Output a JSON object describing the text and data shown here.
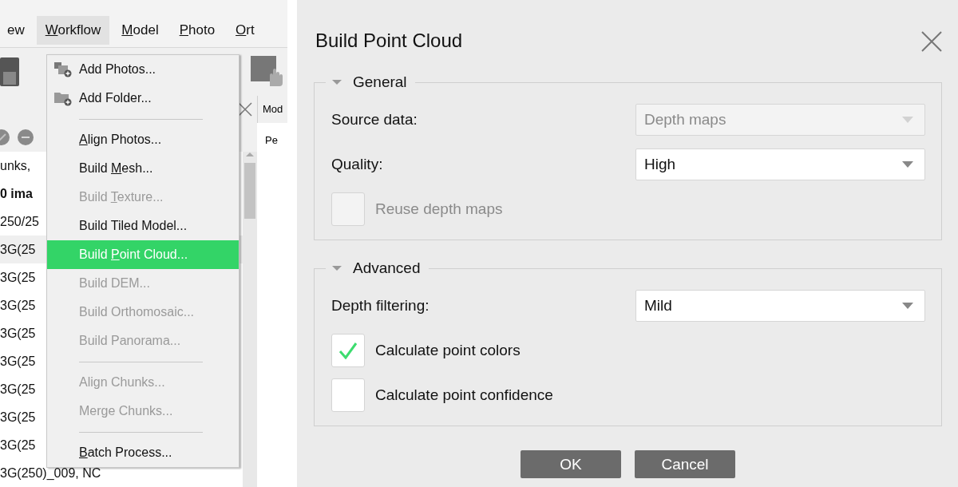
{
  "app": {
    "menubar": [
      {
        "text": "ew",
        "selected": false
      },
      {
        "key": "W",
        "rest": "orkflow",
        "selected": true
      },
      {
        "key": "M",
        "rest": "odel",
        "selected": false
      },
      {
        "key": "P",
        "rest": "hoto",
        "selected": false
      },
      {
        "key": "O",
        "rest": "rt",
        "selected": false
      }
    ],
    "tree_rows": [
      {
        "text": "unks,",
        "bold": false,
        "selected": false
      },
      {
        "text": "0 ima",
        "bold": true,
        "selected": false
      },
      {
        "text": "250/25",
        "bold": false,
        "selected": false
      },
      {
        "text": "3G(25",
        "bold": false,
        "selected": true
      },
      {
        "text": "3G(25",
        "bold": false,
        "selected": false
      },
      {
        "text": "3G(25",
        "bold": false,
        "selected": false
      },
      {
        "text": "3G(25",
        "bold": false,
        "selected": false
      },
      {
        "text": "3G(25",
        "bold": false,
        "selected": false
      },
      {
        "text": "3G(25",
        "bold": false,
        "selected": false
      },
      {
        "text": "3G(25",
        "bold": false,
        "selected": false
      },
      {
        "text": "3G(25",
        "bold": false,
        "selected": false
      },
      {
        "text": "3G(250)_009, NC",
        "bold": false,
        "selected": false
      }
    ],
    "side_tab": "Mod",
    "side_text": "Pe",
    "menu": [
      {
        "kind": "item",
        "text": "Add Photos...",
        "disabled": false,
        "selected": false
      },
      {
        "kind": "item",
        "text": "Add Folder...",
        "disabled": false,
        "selected": false
      },
      {
        "kind": "separator"
      },
      {
        "kind": "item",
        "key": "A",
        "rest": "lign Photos...",
        "disabled": false,
        "selected": false
      },
      {
        "kind": "item",
        "text": "Build ",
        "key": "M",
        "rest": "esh...",
        "disabled": false,
        "selected": false
      },
      {
        "kind": "item",
        "text": "Build ",
        "key": "T",
        "rest": "exture...",
        "disabled": true,
        "selected": false
      },
      {
        "kind": "item",
        "text": "Build Tiled Model...",
        "disabled": false,
        "selected": false
      },
      {
        "kind": "item",
        "text": "Build ",
        "key": "P",
        "rest": "oint Cloud...",
        "disabled": false,
        "selected": true
      },
      {
        "kind": "item",
        "text": "Build DEM...",
        "disabled": true,
        "selected": false
      },
      {
        "kind": "item",
        "text": "Build Orthomosaic...",
        "disabled": true,
        "selected": false
      },
      {
        "kind": "item",
        "text": "Build Panorama...",
        "disabled": true,
        "selected": false
      },
      {
        "kind": "separator"
      },
      {
        "kind": "item",
        "text": "Align Chunks...",
        "disabled": true,
        "selected": false
      },
      {
        "kind": "item",
        "text": "Merge Chunks...",
        "disabled": true,
        "selected": false
      },
      {
        "kind": "separator"
      },
      {
        "kind": "item",
        "key": "B",
        "rest": "atch Process...",
        "disabled": false,
        "selected": false
      }
    ]
  },
  "dialog": {
    "title": "Build Point Cloud",
    "sections": [
      {
        "title": "General",
        "expanded": true,
        "rows": [
          {
            "kind": "select",
            "label": "Source data:",
            "value": "Depth maps",
            "disabled": true
          },
          {
            "kind": "select",
            "label": "Quality:",
            "value": "High",
            "disabled": false
          },
          {
            "kind": "checkbox",
            "label": "Reuse depth maps",
            "checked": false,
            "disabled": true
          }
        ]
      },
      {
        "title": "Advanced",
        "expanded": true,
        "rows": [
          {
            "kind": "select",
            "label": "Depth filtering:",
            "value": "Mild",
            "disabled": false
          },
          {
            "kind": "checkbox",
            "label": "Calculate point colors",
            "checked": true,
            "disabled": false
          },
          {
            "kind": "checkbox",
            "label": "Calculate point confidence",
            "checked": false,
            "disabled": false
          }
        ]
      }
    ],
    "buttons": [
      "OK",
      "Cancel"
    ]
  }
}
